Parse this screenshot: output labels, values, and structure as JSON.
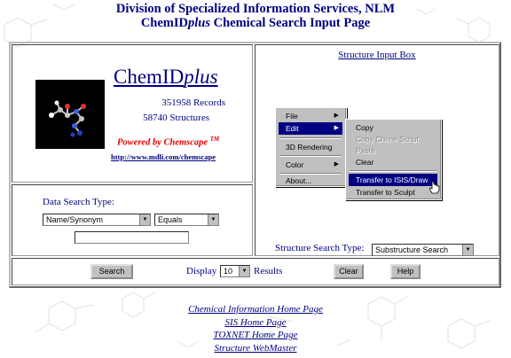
{
  "header": {
    "line1": "Division of Specialized Information Services, NLM",
    "line2_prefix": "ChemID",
    "line2_italic": "plus",
    "line2_suffix": " Chemical Search Input Page"
  },
  "logo": {
    "title_main": "ChemID",
    "title_italic": "plus",
    "records": "351958 Records",
    "structures": "58740 Structures",
    "powered": "Powered by Chemscape",
    "tm": "TM",
    "mdl_link": "http://www.mdli.com/chemscape"
  },
  "structure_box": {
    "link": "Structure Input Box",
    "search_type_label": "Structure Search Type:",
    "search_type_value": "Substructure Search"
  },
  "context_menu": {
    "items": [
      {
        "label": "File",
        "submenu": true
      },
      {
        "label": "Edit",
        "submenu": true,
        "active": true
      },
      {
        "label": "3D Rendering"
      },
      {
        "label": "Color",
        "submenu": true
      },
      {
        "label": "About..."
      }
    ],
    "edit_submenu": [
      {
        "label": "Copy"
      },
      {
        "label": "Copy Chime Script",
        "disabled": true
      },
      {
        "label": "Paste",
        "disabled": true
      },
      {
        "label": "Clear"
      },
      {
        "label": "Transfer to ISIS/Draw",
        "active": true
      },
      {
        "label": "Transfer to Sculpt"
      }
    ]
  },
  "data_search": {
    "label": "Data Search Type:",
    "field_select": "Name/Synonym",
    "operator_select": "Equals",
    "text_value": ""
  },
  "bottom_bar": {
    "search_button": "Search",
    "display_label": "Display",
    "display_value": "10",
    "results_label": "Results",
    "clear_button": "Clear",
    "help_button": "Help"
  },
  "footer": {
    "links": [
      "Chemical Information Home Page",
      "SIS Home Page",
      "TOXNET Home Page",
      "Structure WebMaster"
    ]
  }
}
